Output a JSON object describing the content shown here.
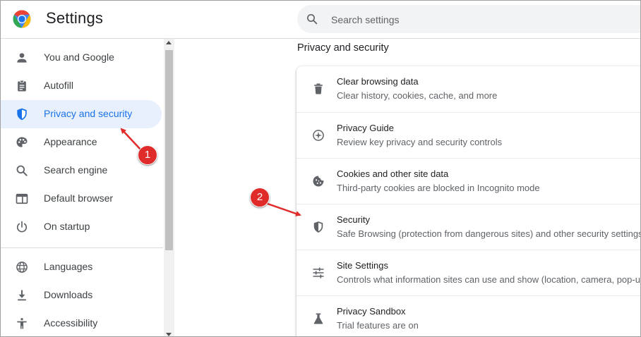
{
  "header": {
    "title": "Settings",
    "search_placeholder": "Search settings"
  },
  "sidebar": {
    "items": [
      {
        "label": "You and Google",
        "icon": "person-icon"
      },
      {
        "label": "Autofill",
        "icon": "clipboard-icon"
      },
      {
        "label": "Privacy and security",
        "icon": "shield-icon",
        "active": true
      },
      {
        "label": "Appearance",
        "icon": "palette-icon"
      },
      {
        "label": "Search engine",
        "icon": "search-icon"
      },
      {
        "label": "Default browser",
        "icon": "browser-window-icon"
      },
      {
        "label": "On startup",
        "icon": "power-icon"
      },
      {
        "label": "Languages",
        "icon": "globe-icon"
      },
      {
        "label": "Downloads",
        "icon": "download-icon"
      },
      {
        "label": "Accessibility",
        "icon": "accessibility-icon"
      }
    ]
  },
  "main": {
    "section_title": "Privacy and security",
    "rows": [
      {
        "title": "Clear browsing data",
        "subtitle": "Clear history, cookies, cache, and more",
        "icon": "trash-icon"
      },
      {
        "title": "Privacy Guide",
        "subtitle": "Review key privacy and security controls",
        "icon": "compass-icon"
      },
      {
        "title": "Cookies and other site data",
        "subtitle": "Third-party cookies are blocked in Incognito mode",
        "icon": "cookie-icon"
      },
      {
        "title": "Security",
        "subtitle": "Safe Browsing (protection from dangerous sites) and other security settings",
        "icon": "security-shield-icon"
      },
      {
        "title": "Site Settings",
        "subtitle": "Controls what information sites can use and show (location, camera, pop-ups, and more)",
        "icon": "sliders-icon"
      },
      {
        "title": "Privacy Sandbox",
        "subtitle": "Trial features are on",
        "icon": "flask-icon"
      }
    ]
  },
  "callouts": [
    {
      "label": "1"
    },
    {
      "label": "2"
    }
  ],
  "colors": {
    "accent": "#1a73e8",
    "active_bg": "#e8f0fe",
    "callout": "#e02b2b"
  }
}
